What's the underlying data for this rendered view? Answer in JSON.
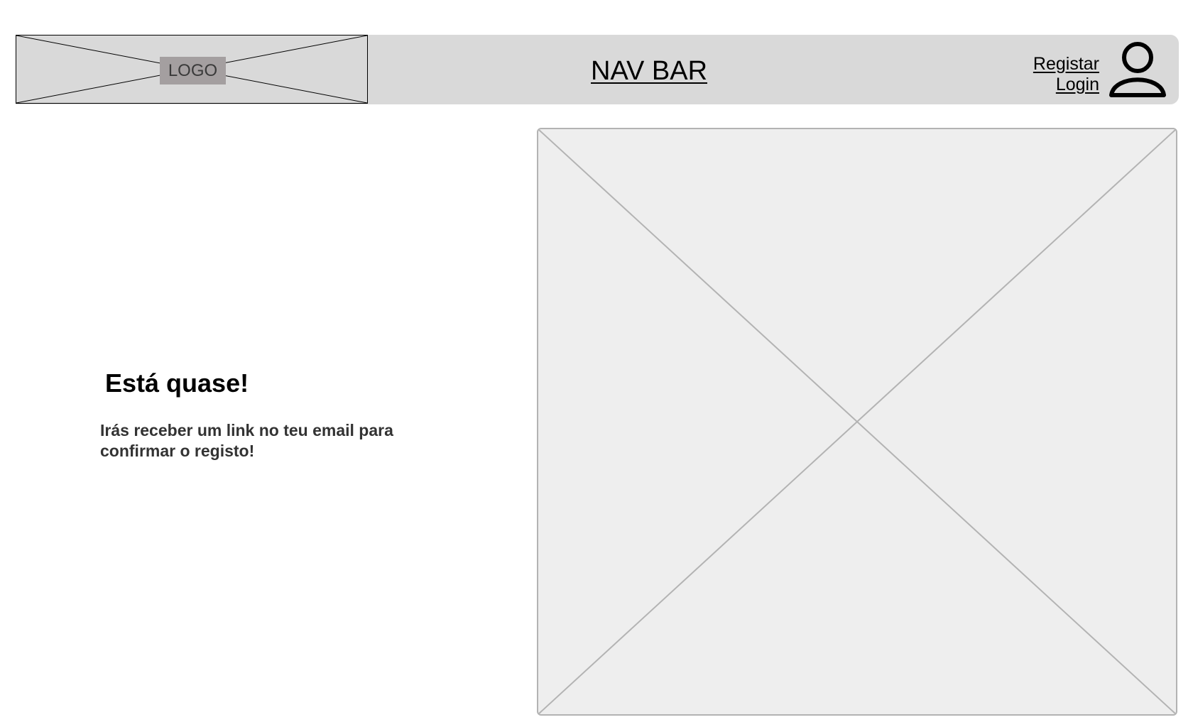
{
  "navbar": {
    "logo_label": "LOGO",
    "title": "NAV BAR",
    "register_link": "Registar",
    "login_link": "Login",
    "user_icon": "user-icon"
  },
  "main": {
    "heading": "Está quase!",
    "message": "Irás receber um link no teu email para confirmar o registo!",
    "image_placeholder_icon": "image-placeholder"
  },
  "colors": {
    "navbar_background": "#d9d9d9",
    "logo_label_background": "#a49fa0",
    "placeholder_background": "#eeeeee",
    "placeholder_border": "#b3b3b3"
  }
}
